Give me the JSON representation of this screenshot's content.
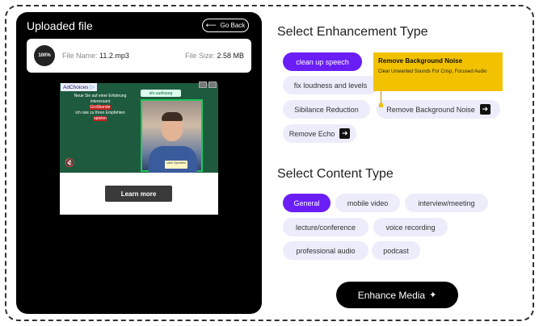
{
  "left": {
    "title": "Uploaded file",
    "back_label": "Go Back",
    "file": {
      "progress": "100%",
      "name_label": "File Name:",
      "name": "11.2.mp3",
      "size_label": "File Size:",
      "size": "2.58 MB"
    },
    "ad": {
      "adchoices": "AdChoices",
      "logo_tag": "afo.audiopeg",
      "lines": [
        "Neue Sie auf einer Erfahrung",
        "interessant",
        "Großkunde",
        "ich rate zu Ihren Empfehlen",
        "spielen"
      ],
      "person_tag": "Uwe Sprotten",
      "cta": "Learn more"
    }
  },
  "enhancement": {
    "title": "Select Enhancement Type",
    "options": [
      {
        "label": "clean up speech",
        "active": true
      },
      {
        "label": "fix loudness and levels",
        "active": false
      },
      {
        "label": "Sibilance Reduction",
        "active": false
      },
      {
        "label": "Remove Background Noise",
        "active": false
      },
      {
        "label": "Remove Echo",
        "active": false
      }
    ],
    "tooltip": {
      "title": "Remove Background Noise",
      "desc": "Clear Unwanted Sounds For Crisp, Focused Audio"
    }
  },
  "content": {
    "title": "Select Content Type",
    "options": [
      {
        "label": "General",
        "active": true
      },
      {
        "label": "mobile video",
        "active": false
      },
      {
        "label": "interview/meeting",
        "active": false
      },
      {
        "label": "lecture/conference",
        "active": false
      },
      {
        "label": "voice recording",
        "active": false
      },
      {
        "label": "professional audio",
        "active": false
      },
      {
        "label": "podcast",
        "active": false
      }
    ]
  },
  "enhance_button": "Enhance Media",
  "colors": {
    "accent": "#6a1ef5",
    "chip_bg": "#ececfb",
    "tooltip_bg": "#f2c200"
  }
}
